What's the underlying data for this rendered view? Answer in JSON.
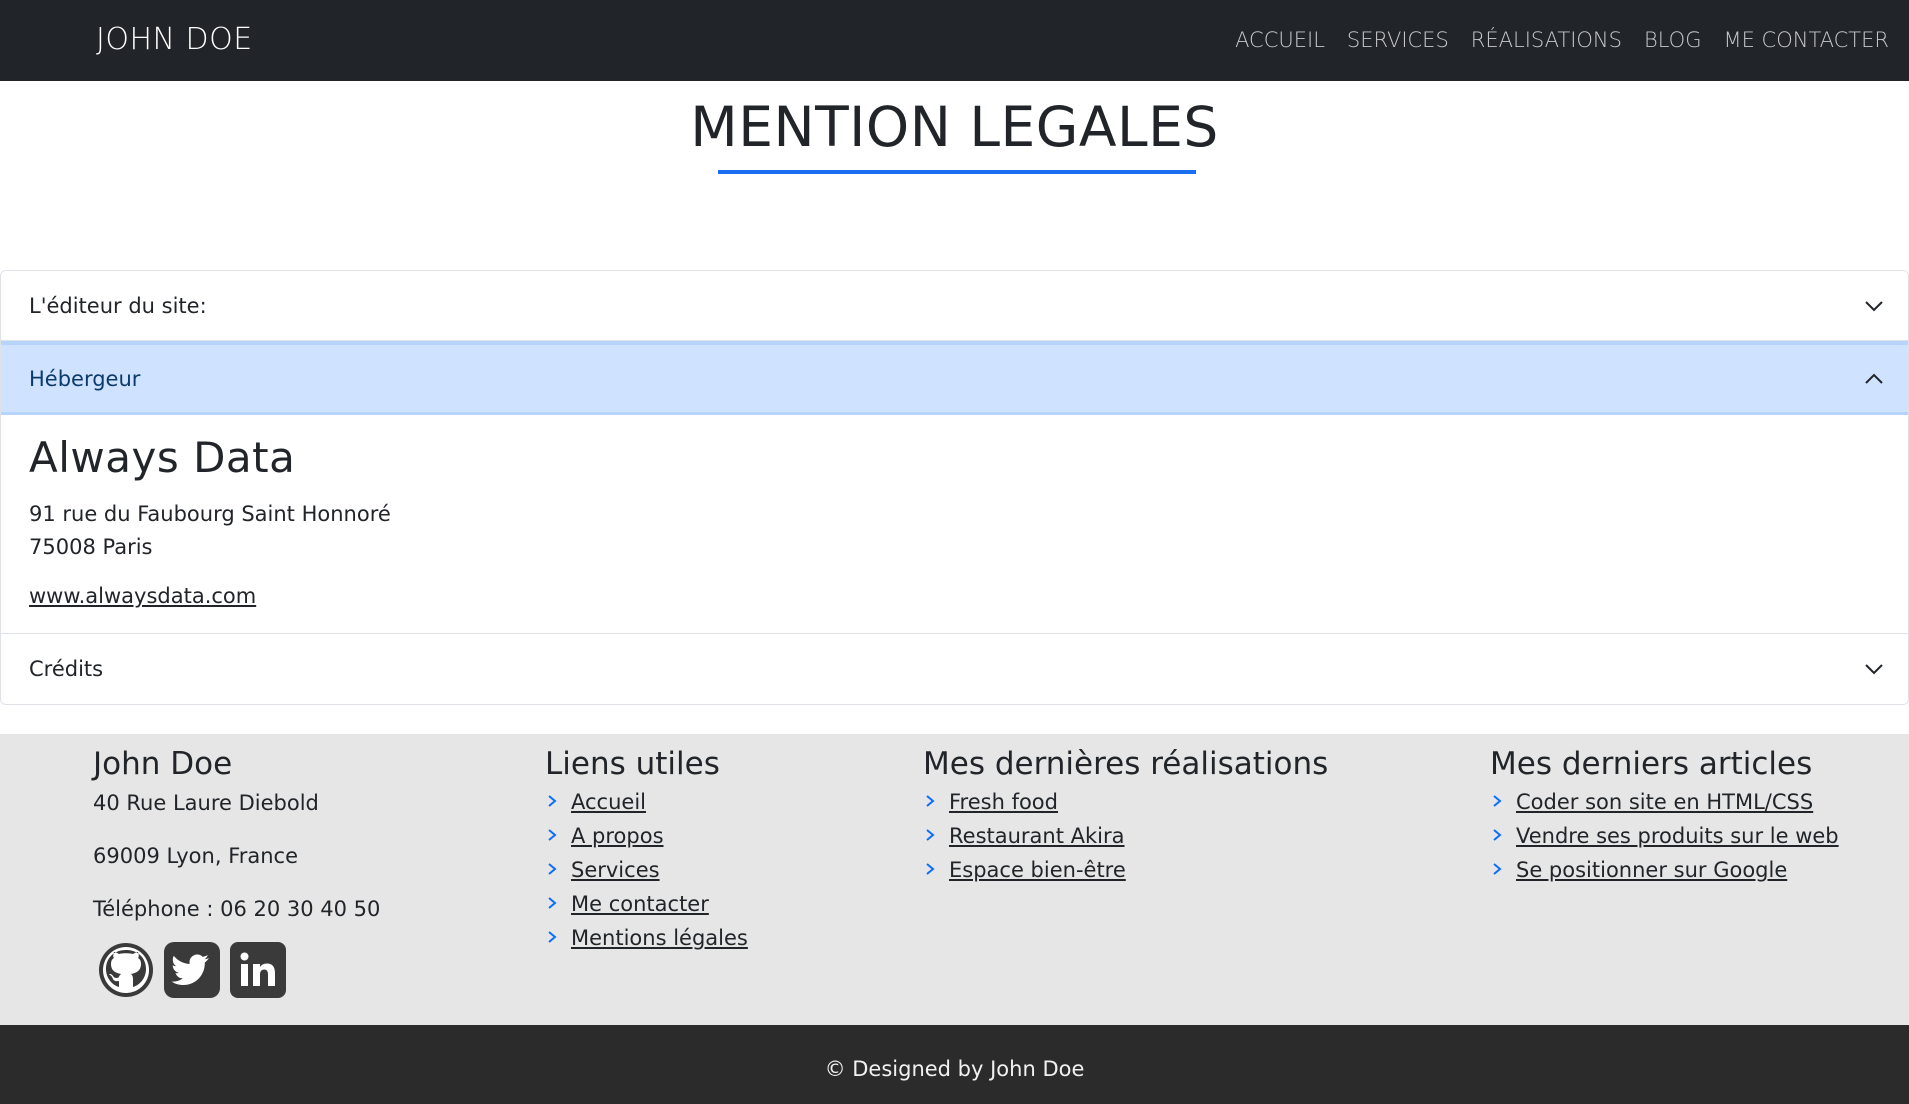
{
  "navbar": {
    "brand": "JOHN DOE",
    "links": [
      "ACCUEIL",
      "SERVICES",
      "RÉALISATIONS",
      "BLOG",
      "ME CONTACTER"
    ]
  },
  "page": {
    "title": "MENTION LEGALES",
    "accent_color": "#1a6ef0"
  },
  "accordion": {
    "items": [
      {
        "label": "L'éditeur du site:",
        "expanded": false
      },
      {
        "label": "Hébergeur",
        "expanded": true
      },
      {
        "label": "Crédits",
        "expanded": false
      }
    ],
    "host": {
      "name": "Always Data",
      "address1": "91 rue du Faubourg Saint Honnoré",
      "address2": "75008 Paris",
      "website": "www.alwaysdata.com"
    }
  },
  "footer": {
    "contact": {
      "name": "John Doe",
      "street": "40 Rue Laure Diebold",
      "city": "69009 Lyon, France",
      "phone": "Téléphone : 06 20 30 40 50"
    },
    "useful_links": {
      "title": "Liens utiles",
      "items": [
        "Accueil",
        "A propos",
        "Services",
        "Me contacter",
        "Mentions légales"
      ]
    },
    "projects": {
      "title": "Mes dernières réalisations",
      "items": [
        "Fresh food",
        "Restaurant Akira",
        "Espace bien-être"
      ]
    },
    "articles": {
      "title": "Mes derniers articles",
      "items": [
        "Coder son site en HTML/CSS",
        "Vendre ses produits sur le web",
        "Se positionner sur Google"
      ]
    },
    "socials": [
      "github-icon",
      "twitter-icon",
      "linkedin-icon"
    ],
    "copyright": "© Designed by John Doe"
  }
}
